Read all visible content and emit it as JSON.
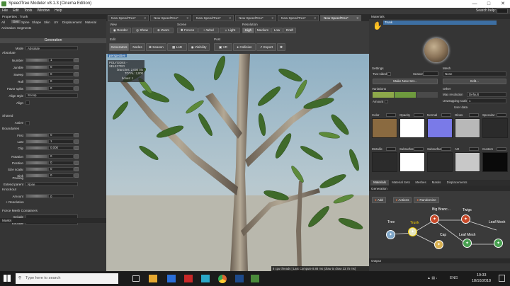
{
  "window": {
    "title": "SpeedTree Modeler v8.1.3 (Cinema Edition)"
  },
  "menu": {
    "items": [
      "File",
      "Edit",
      "Tools",
      "Window",
      "Help"
    ],
    "search_label": "Search help:"
  },
  "properties": {
    "header": "Properties : Trunk",
    "tabs": [
      "All",
      "Gen",
      "Spine",
      "Shape",
      "Skin",
      "UV",
      "Displacement",
      "Material"
    ],
    "tabs2": [
      "Animation",
      "Segments"
    ],
    "generation_section": "Generation",
    "mode_label": "Mode",
    "mode_value": "Absolute",
    "absolute_label": "Absolute",
    "rows": [
      {
        "label": "Number",
        "value": "1"
      },
      {
        "label": "Jumble",
        "value": "0"
      },
      {
        "label": "Sweep",
        "value": "0"
      },
      {
        "label": "Roll",
        "value": "0"
      },
      {
        "label": "Favor splits",
        "value": "0"
      },
      {
        "label": "Align style",
        "value": "Scoop"
      },
      {
        "label": "Align",
        "value": ""
      }
    ],
    "shared_label": "Shared",
    "active_label": "Active",
    "boundaries_label": "Boundaries",
    "brows": [
      {
        "label": "First",
        "value": "0"
      },
      {
        "label": "Last",
        "value": "1"
      },
      {
        "label": "Clip",
        "value": "0.000"
      },
      {
        "label": "Rotation",
        "value": "0"
      },
      {
        "label": "Position",
        "value": "0"
      },
      {
        "label": "Size scalar",
        "value": "0"
      },
      {
        "label": "Sink",
        "value": "0"
      }
    ],
    "pruning_label": "Pruning",
    "extend_label": "Extend parent",
    "extend_value": "None",
    "knockout_label": "Knockout",
    "amount_label": "Amount",
    "amount_value": "0",
    "resolution_label": "+ Resolution",
    "force_label": "Force Mesh Containers",
    "include_label": "Include",
    "exclude_label": "Exclude",
    "masks_header": "Masks"
  },
  "doc_tabs": [
    "New SpeedTree*",
    "New SpeedTree*",
    "New SpeedTree*",
    "New SpeedTree*",
    "New SpeedTree*",
    "New SpeedTree*"
  ],
  "toolbar": {
    "view_label": "View",
    "scene_label": "Scene",
    "resolution_label": "Resolution",
    "view_buttons": [
      "Render",
      "Show",
      "Zoom"
    ],
    "scene_buttons": [
      "Forces",
      "Wind",
      "Light"
    ],
    "res_buttons": [
      "High",
      "Medium",
      "Low",
      "Draft"
    ],
    "edit_label": "Edit",
    "post_label": "Post",
    "edit_buttons": [
      "Generators",
      "Nodes",
      "Season",
      "LoD",
      "Visibility"
    ],
    "post_buttons": [
      "VR",
      "Collision",
      "Export"
    ]
  },
  "viewport": {
    "perspective": "perspective",
    "polygons_title": "POLYGONS - SELECTED",
    "branches": "branches: 2,000 tris",
    "total": "TOTAL: 2,000",
    "bones": "bones: 1",
    "status": "8 cpu threads | Last Compute 8.88 ms (draw to draw 23.75 ms)"
  },
  "materials": {
    "header": "Materials",
    "name": "Trunk",
    "settings_label": "Settings",
    "mesh_label": "Mesh",
    "two_sided": "Two-sided",
    "season_label": "Season",
    "mesh_value": "None",
    "make_new_set": "Make New Set...",
    "edit_label": "Edit...",
    "variations_label": "Variations",
    "other_label": "Other",
    "max_res_label": "Max resolution",
    "max_res_value": "Default",
    "unwrap_label": "Unwrapping scale",
    "unwrap_value": "1",
    "amount_label": "Amount",
    "user_data_label": "User data",
    "maps_row1": [
      "Color",
      "Opacity",
      "Normal",
      "Gloss",
      "Specular"
    ],
    "maps_row2": [
      "Metallic",
      "Subsurface",
      "Subsurface%",
      "AO",
      "Custom"
    ],
    "bottom_tabs": [
      "Materials",
      "Material Sets",
      "Meshes",
      "Masks",
      "Displacements"
    ]
  },
  "generation": {
    "header": "Generation",
    "buttons": [
      "Add",
      "Actions",
      "Randomize"
    ],
    "nodes": [
      {
        "label": "Tree",
        "color": "#7fa6c8"
      },
      {
        "label": "Trunk",
        "color": "#e7e7c0"
      },
      {
        "label": "Big Branc...",
        "color": "#c84a2a"
      },
      {
        "label": "Twigs",
        "color": "#c84a2a"
      },
      {
        "label": "Cap",
        "color": "#d8b050"
      },
      {
        "label": "Leaf Mesh",
        "color": "#48a050"
      },
      {
        "label": "Leaf Mesh",
        "color": "#48a050"
      }
    ]
  },
  "output": {
    "header": "Output"
  },
  "taskbar": {
    "search_placeholder": "Type here to search",
    "time": "19:33",
    "date": "18/10/2018",
    "lang": "ENG"
  },
  "colors": {
    "accent": "#3d6fa3",
    "panel": "#353535",
    "node_sel": "#f5d000"
  }
}
